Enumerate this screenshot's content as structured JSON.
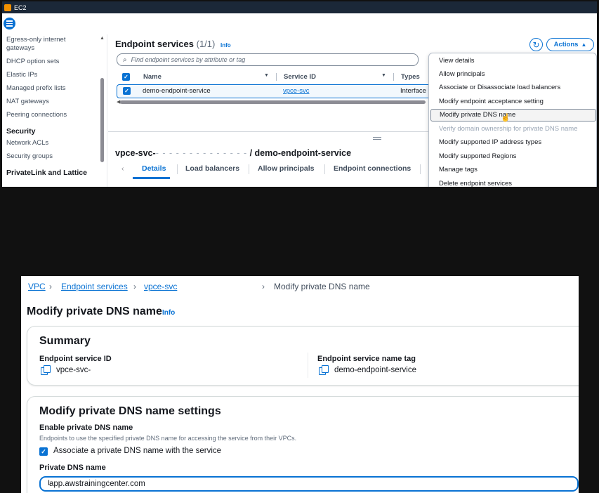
{
  "top": {
    "app_title": "EC2",
    "nav": {
      "items": [
        "Egress-only internet gateways",
        "DHCP option sets",
        "Elastic IPs",
        "Managed prefix lists",
        "NAT gateways",
        "Peering connections"
      ],
      "security_head": "Security",
      "security_items": [
        "Network ACLs",
        "Security groups"
      ],
      "privatelink_head": "PrivateLink and Lattice"
    },
    "endpoint_services": {
      "title": "Endpoint services",
      "count": "(1/1)",
      "info": "Info",
      "actions_label": "Actions",
      "search_placeholder": "Find endpoint services by attribute or tag",
      "columns": [
        "Name",
        "Service ID",
        "Types"
      ],
      "row": {
        "name": "demo-endpoint-service",
        "service_id": "vpce-svc",
        "type": "Interface"
      }
    },
    "detail": {
      "title_prefix": "vpce-svc-",
      "title_masked": "- - - - - - - - - - - - - -",
      "title_suffix": " / demo-endpoint-service",
      "tabs": [
        "Details",
        "Load balancers",
        "Allow principals",
        "Endpoint connections"
      ]
    },
    "actions_menu": [
      {
        "label": "View details",
        "state": "normal"
      },
      {
        "label": "Allow principals",
        "state": "normal"
      },
      {
        "label": "Associate or Disassociate load balancers",
        "state": "normal"
      },
      {
        "label": "Modify endpoint acceptance setting",
        "state": "normal"
      },
      {
        "label": "Modify private DNS name",
        "state": "hover"
      },
      {
        "label": "Verify domain ownership for private DNS name",
        "state": "disabled"
      },
      {
        "label": "Modify supported IP address types",
        "state": "normal"
      },
      {
        "label": "Modify supported Regions",
        "state": "normal"
      },
      {
        "label": "Manage tags",
        "state": "normal"
      },
      {
        "label": "Delete endpoint services",
        "state": "normal"
      }
    ]
  },
  "bottom": {
    "breadcrumb": {
      "vpc": "VPC",
      "endpoint_services": "Endpoint services",
      "service": "vpce-svc",
      "current": "Modify private DNS name"
    },
    "page_title": "Modify private DNS name",
    "page_info": "Info",
    "summary": {
      "title": "Summary",
      "service_id_label": "Endpoint service ID",
      "service_id_value": "vpce-svc-",
      "name_tag_label": "Endpoint service name tag",
      "name_tag_value": "demo-endpoint-service"
    },
    "settings": {
      "title": "Modify private DNS name settings",
      "enable_label": "Enable private DNS name",
      "enable_desc": "Endpoints to use the specified private DNS name for accessing the service from their VPCs.",
      "checkbox_label": "Associate a private DNS name with the service",
      "dns_label": "Private DNS name",
      "dns_value": "app.awstrainingcenter.com"
    }
  },
  "colors": {
    "accent": "#0972d3",
    "titlebar": "#1b2838",
    "background": "#111111"
  }
}
